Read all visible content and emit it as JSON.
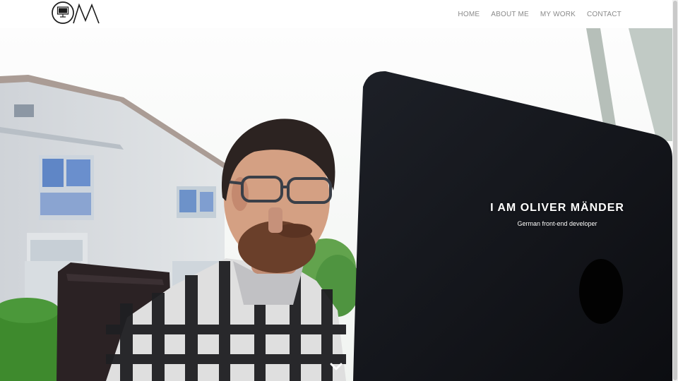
{
  "header": {
    "nav": {
      "home": "HOME",
      "about": "ABOUT ME",
      "work": "MY WORK",
      "contact": "CONTACT"
    }
  },
  "hero": {
    "title": "I AM OLIVER MÄNDER",
    "subtitle": "German front-end developer"
  },
  "icons": {
    "logo": "om-monitor-logo",
    "scroll": "chevron-down-icon"
  },
  "colors": {
    "nav_text": "#8a8a8a",
    "hero_text": "#ffffff",
    "laptop": "#111318"
  }
}
